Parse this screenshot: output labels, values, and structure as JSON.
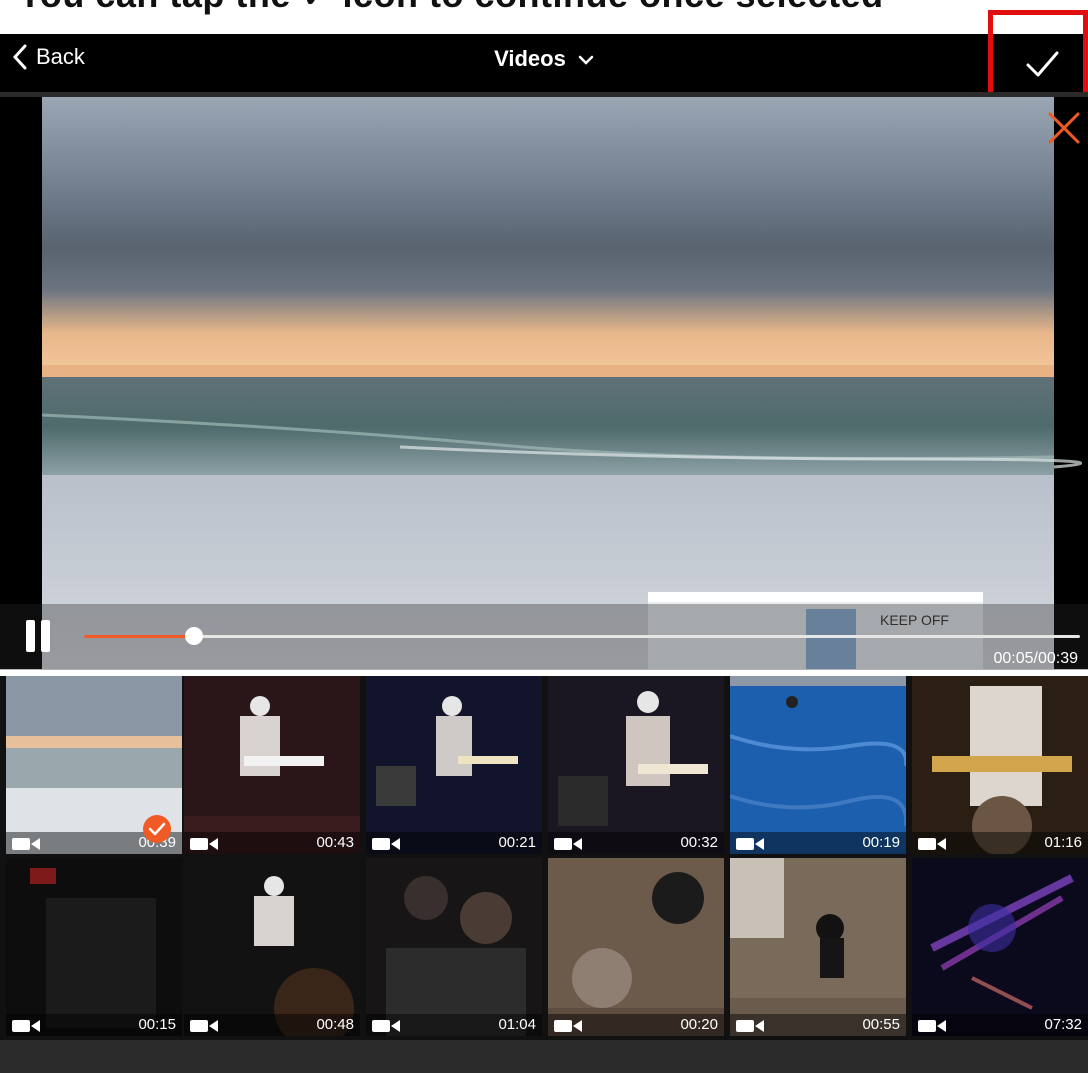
{
  "caption": "You can tap the ✓ icon to continue once selected",
  "header": {
    "back_label": "Back",
    "title": "Videos"
  },
  "player": {
    "time": "00:05/00:39",
    "progress_fraction": 0.11
  },
  "colors": {
    "accent": "#f15a24",
    "highlight": "#e10e0e"
  },
  "grid": {
    "row1": [
      {
        "dur": "00:39",
        "selected": true
      },
      {
        "dur": "00:43"
      },
      {
        "dur": "00:21"
      },
      {
        "dur": "00:32"
      },
      {
        "dur": "00:19"
      },
      {
        "dur": "01:16"
      }
    ],
    "row2": [
      {
        "dur": "00:15"
      },
      {
        "dur": "00:48"
      },
      {
        "dur": "01:04"
      },
      {
        "dur": "00:20"
      },
      {
        "dur": "00:55"
      },
      {
        "dur": "07:32"
      }
    ]
  },
  "icons": [
    "chevron-left-icon",
    "chevron-down-icon",
    "checkmark-icon",
    "close-icon",
    "pause-icon",
    "video-camera-icon",
    "selected-check-icon"
  ]
}
